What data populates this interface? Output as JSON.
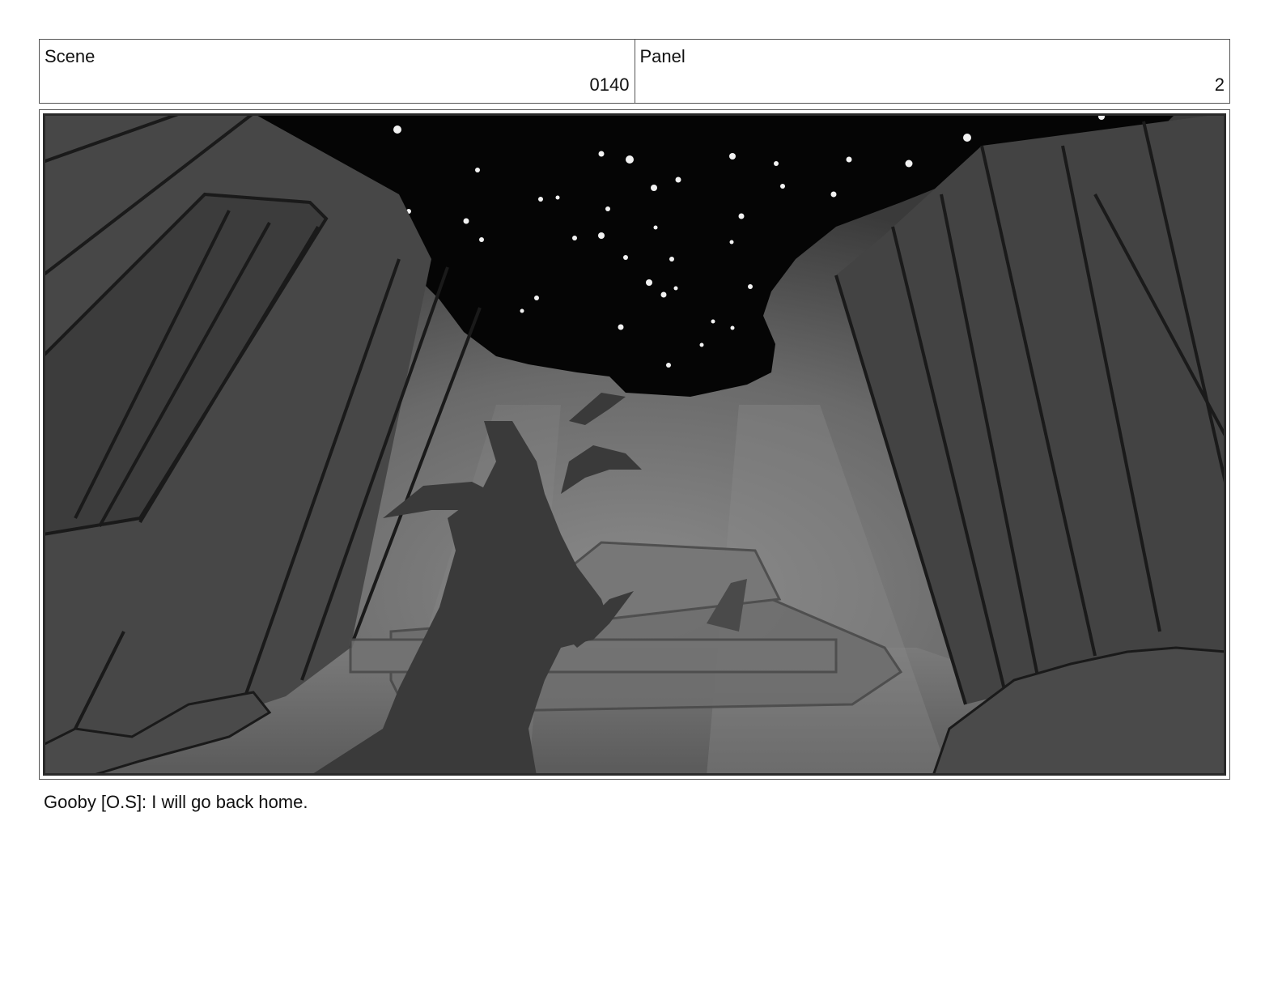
{
  "header": {
    "scene_label": "Scene",
    "scene_value": "0140",
    "panel_label": "Panel",
    "panel_value": "2"
  },
  "panel": {
    "image": "storyboard-drawing",
    "style": "grayscale"
  },
  "caption": {
    "dialogue": "Gooby [O.S]: I will go back home."
  }
}
